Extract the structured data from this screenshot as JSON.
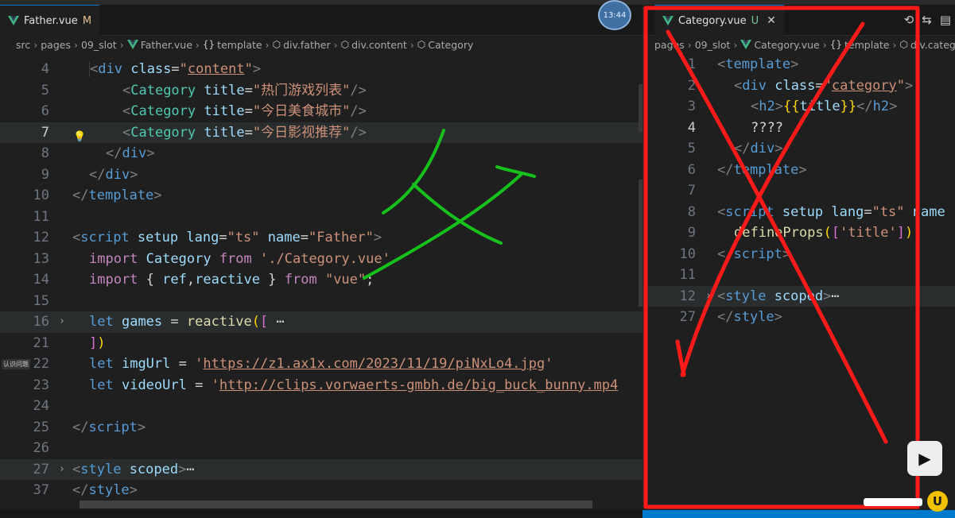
{
  "left_editor": {
    "tab": {
      "label": "Father.vue",
      "status": "M"
    },
    "breadcrumb": [
      "src",
      "pages",
      "09_slot",
      "Father.vue",
      "template",
      "div.father",
      "div.content",
      "Category"
    ],
    "lines": [
      {
        "n": "4"
      },
      {
        "n": "5"
      },
      {
        "n": "6"
      },
      {
        "n": "7"
      },
      {
        "n": "8"
      },
      {
        "n": "9"
      },
      {
        "n": "10"
      },
      {
        "n": "11"
      },
      {
        "n": "12"
      },
      {
        "n": "13"
      },
      {
        "n": "14"
      },
      {
        "n": "15"
      },
      {
        "n": "16"
      },
      {
        "n": "21"
      },
      {
        "n": "22"
      },
      {
        "n": "23"
      },
      {
        "n": "24"
      },
      {
        "n": "25"
      },
      {
        "n": "26"
      },
      {
        "n": "27"
      },
      {
        "n": "37"
      }
    ],
    "code": {
      "l4_cls": "content",
      "l5_title": "热门游戏列表",
      "l6_title": "今日美食城市",
      "l7_title": "今日影视推荐",
      "l12_lang": "ts",
      "l12_name": "Father",
      "l13_path": "./Category.vue",
      "l14_path": "vue",
      "l22_url": "https://z1.ax1x.com/2023/11/19/piNxLo4.jpg",
      "l23_url": "http://clips.vorwaerts-gmbh.de/big_buck_bunny.mp4"
    }
  },
  "right_editor": {
    "tab": {
      "label": "Category.vue",
      "status": "U"
    },
    "breadcrumb": [
      "pages",
      "09_slot",
      "Category.vue",
      "template",
      "div.catego"
    ],
    "lines": [
      {
        "n": "1"
      },
      {
        "n": "2"
      },
      {
        "n": "3"
      },
      {
        "n": "4"
      },
      {
        "n": "5"
      },
      {
        "n": "6"
      },
      {
        "n": "7"
      },
      {
        "n": "8"
      },
      {
        "n": "9"
      },
      {
        "n": "10"
      },
      {
        "n": "11"
      },
      {
        "n": "12"
      },
      {
        "n": "27"
      }
    ],
    "code": {
      "l2_cls": "category",
      "l4_text": "????",
      "l8_lang": "ts",
      "l8_name": "name",
      "l9_prop": "title"
    }
  },
  "overlay": {
    "avatar_time": "13:44",
    "side_label": "认识问题",
    "annotation_char": "父",
    "annotation_color": "#17c11b",
    "box_color": "#ff1a1a"
  },
  "colors": {
    "tag": "#569cd6",
    "attr": "#9cdcfe",
    "string": "#ce9178",
    "import": "#c586c0"
  }
}
